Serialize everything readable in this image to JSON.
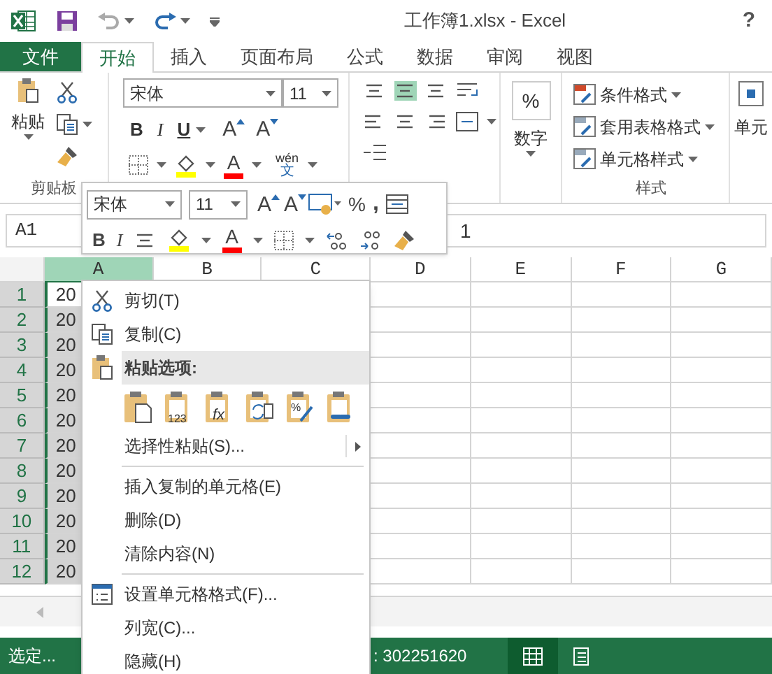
{
  "window": {
    "title": "工作簿1.xlsx - Excel",
    "help": "?"
  },
  "tabs": [
    {
      "label": "文件",
      "kind": "file",
      "selected": false
    },
    {
      "label": "开始",
      "kind": "tab",
      "selected": true
    },
    {
      "label": "插入",
      "kind": "tab",
      "selected": false
    },
    {
      "label": "页面布局",
      "kind": "tab",
      "selected": false
    },
    {
      "label": "公式",
      "kind": "tab",
      "selected": false
    },
    {
      "label": "数据",
      "kind": "tab",
      "selected": false
    },
    {
      "label": "审阅",
      "kind": "tab",
      "selected": false
    },
    {
      "label": "视图",
      "kind": "tab",
      "selected": false
    }
  ],
  "ribbon": {
    "clipboard": {
      "paste": "粘贴",
      "group_label": "剪贴板"
    },
    "font": {
      "name": "宋体",
      "size": "11",
      "bold": "B",
      "italic": "I",
      "underline": "U",
      "grow": "A",
      "shrink": "A",
      "font_color": "A",
      "phonetic_top": "wén",
      "phonetic_bottom": "文"
    },
    "number": {
      "symbol": "%",
      "label": "数字"
    },
    "styles": {
      "items": [
        "条件格式",
        "套用表格格式",
        "单元格样式"
      ],
      "group_label": "样式"
    },
    "cells": {
      "label": "单元"
    }
  },
  "mini_toolbar": {
    "font": "宋体",
    "size": "11",
    "grow": "A",
    "shrink": "A",
    "percent": "%",
    "comma": ",",
    "bold": "B",
    "italic": "I",
    "font_color": "A"
  },
  "name_box": "A1",
  "formula": "1",
  "columns": [
    {
      "label": "A",
      "selected": true
    },
    {
      "label": "B",
      "selected": false
    },
    {
      "label": "C",
      "selected": false
    },
    {
      "label": "D",
      "selected": false
    },
    {
      "label": "E",
      "selected": false
    },
    {
      "label": "F",
      "selected": false
    },
    {
      "label": "G",
      "selected": false
    }
  ],
  "rows": [
    {
      "number": "1",
      "value": "20"
    },
    {
      "number": "2",
      "value": "20"
    },
    {
      "number": "3",
      "value": "20"
    },
    {
      "number": "4",
      "value": "20"
    },
    {
      "number": "5",
      "value": "20"
    },
    {
      "number": "6",
      "value": "20"
    },
    {
      "number": "7",
      "value": "20"
    },
    {
      "number": "8",
      "value": "20"
    },
    {
      "number": "9",
      "value": "20"
    },
    {
      "number": "10",
      "value": "20"
    },
    {
      "number": "11",
      "value": "20"
    },
    {
      "number": "12",
      "value": "20"
    }
  ],
  "status_bar": {
    "mode": "选定...",
    "sum": ": 302251620",
    "views": [
      {
        "selected": true
      },
      {
        "selected": false
      }
    ]
  },
  "context_menu": [
    {
      "kind": "command",
      "label": "剪切(T)"
    },
    {
      "kind": "command",
      "label": "复制(C)"
    },
    {
      "kind": "header",
      "label": "粘贴选项:"
    },
    {
      "kind": "paste_icons",
      "badges": [
        "123",
        "fx",
        "%"
      ]
    },
    {
      "kind": "submenu",
      "label": "选择性粘贴(S)..."
    },
    {
      "kind": "separator"
    },
    {
      "kind": "command",
      "label": "插入复制的单元格(E)"
    },
    {
      "kind": "command",
      "label": "删除(D)"
    },
    {
      "kind": "command",
      "label": "清除内容(N)"
    },
    {
      "kind": "separator"
    },
    {
      "kind": "command",
      "label": "设置单元格格式(F)..."
    },
    {
      "kind": "command",
      "label": "列宽(C)..."
    },
    {
      "kind": "command",
      "label": "隐藏(H)"
    }
  ]
}
